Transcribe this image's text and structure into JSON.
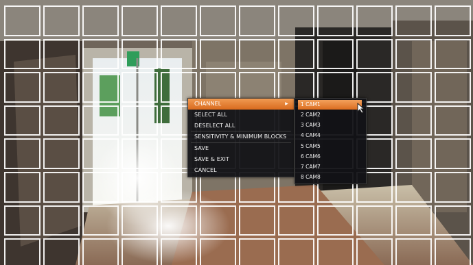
{
  "menu": {
    "items": [
      {
        "label": "CHANNEL",
        "submenu": true,
        "highlighted": true
      },
      {
        "label": "SELECT ALL"
      },
      {
        "label": "DESELECT ALL"
      },
      {
        "label": "SENSITIVITY & MINIMUM BLOCKS"
      },
      {
        "label": "SAVE"
      },
      {
        "label": "SAVE & EXIT"
      },
      {
        "label": "CANCEL"
      }
    ]
  },
  "channel_submenu": {
    "items": [
      {
        "label": "1 CAM1",
        "highlighted": true
      },
      {
        "label": "2 CAM2"
      },
      {
        "label": "3 CAM3"
      },
      {
        "label": "4 CAM4"
      },
      {
        "label": "5 CAM5"
      },
      {
        "label": "6 CAM6"
      },
      {
        "label": "7 CAM7"
      },
      {
        "label": "8 CAM8"
      }
    ]
  },
  "icons": {
    "submenu_arrow": "triangle-right-icon",
    "cursor": "mouse-pointer-icon"
  },
  "colors": {
    "highlight": "#e57a2e",
    "grid_line": "#ffffff",
    "menu_bg": "#121216"
  }
}
